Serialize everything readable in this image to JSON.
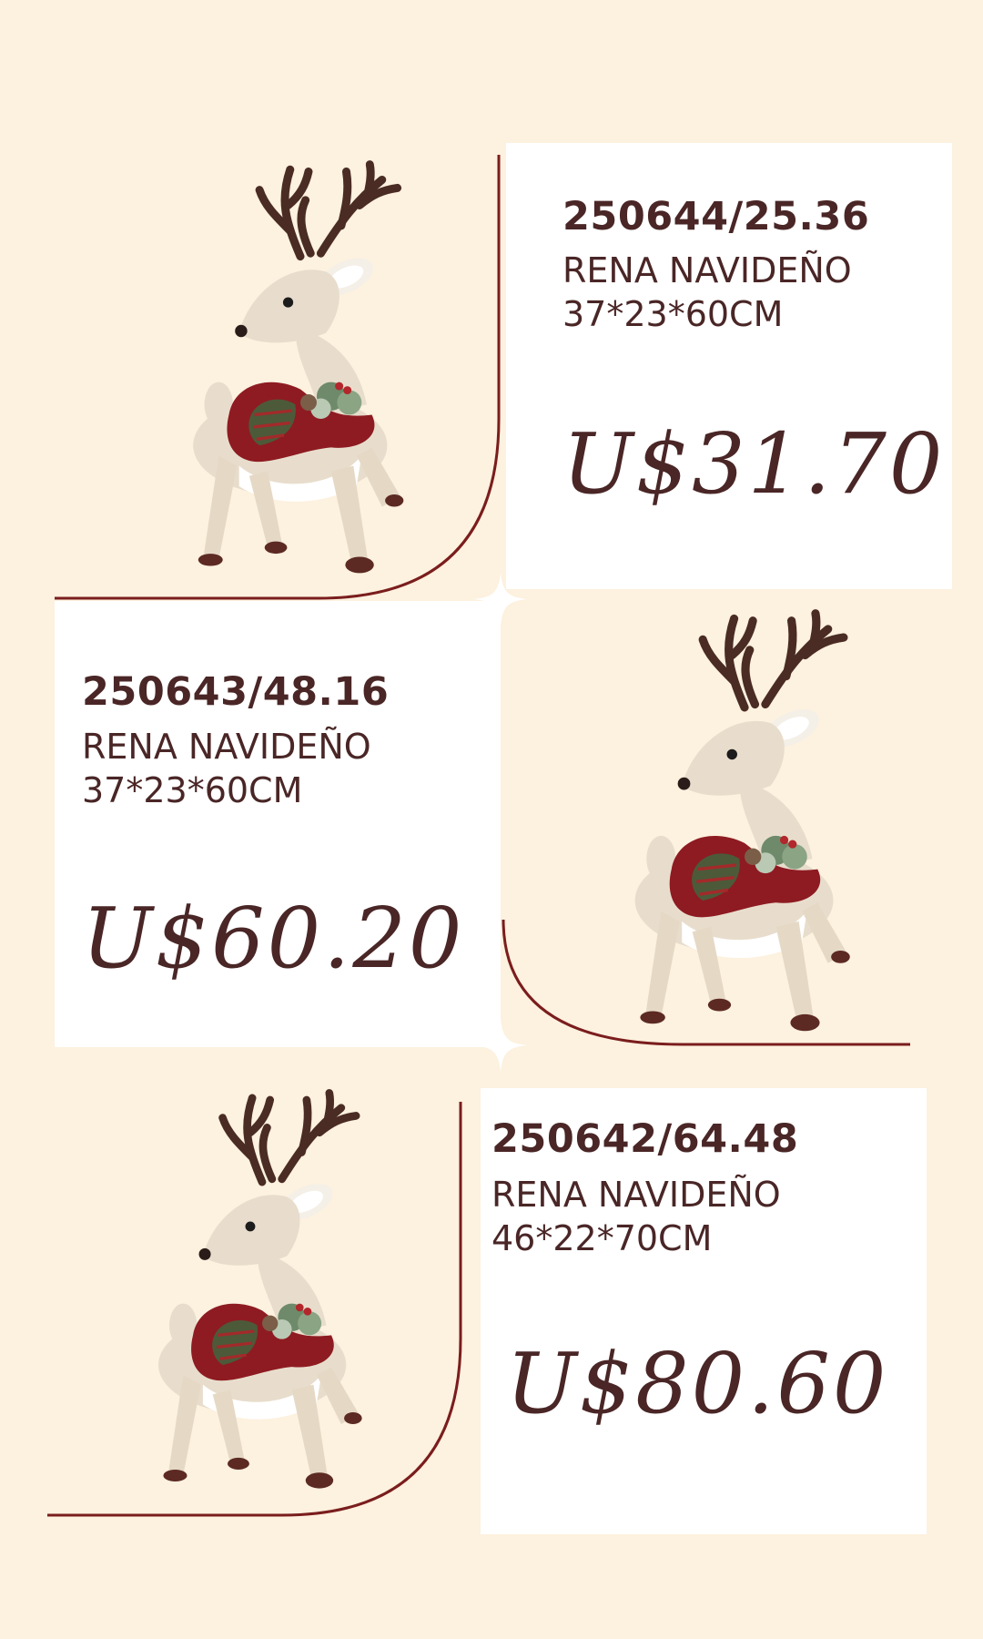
{
  "colors": {
    "background": "#fdf1df",
    "card": "#ffffff",
    "text": "#4a2626",
    "accent_line": "#7a1d1d"
  },
  "products": [
    {
      "code": "250644/25.36",
      "name": "RENA NAVIDEÑO",
      "dimensions": "37*23*60CM",
      "price": "U$31.70",
      "image_icon": "reindeer-figurine-icon"
    },
    {
      "code": "250643/48.16",
      "name": "RENA NAVIDEÑO",
      "dimensions": "37*23*60CM",
      "price": "U$60.20",
      "image_icon": "reindeer-figurine-icon"
    },
    {
      "code": "250642/64.48",
      "name": "RENA NAVIDEÑO",
      "dimensions": "46*22*70CM",
      "price": "U$80.60",
      "image_icon": "reindeer-figurine-icon"
    }
  ]
}
